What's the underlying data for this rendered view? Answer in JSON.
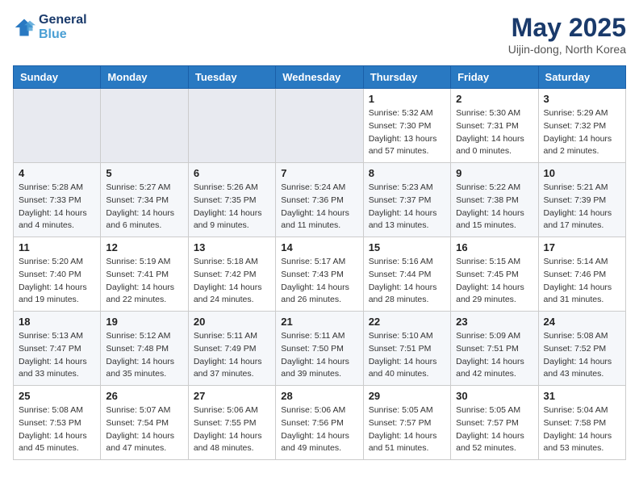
{
  "header": {
    "logo_line1": "General",
    "logo_line2": "Blue",
    "month_title": "May 2025",
    "location": "Uijin-dong, North Korea"
  },
  "weekdays": [
    "Sunday",
    "Monday",
    "Tuesday",
    "Wednesday",
    "Thursday",
    "Friday",
    "Saturday"
  ],
  "weeks": [
    [
      {
        "day": "",
        "info": ""
      },
      {
        "day": "",
        "info": ""
      },
      {
        "day": "",
        "info": ""
      },
      {
        "day": "",
        "info": ""
      },
      {
        "day": "1",
        "info": "Sunrise: 5:32 AM\nSunset: 7:30 PM\nDaylight: 13 hours\nand 57 minutes."
      },
      {
        "day": "2",
        "info": "Sunrise: 5:30 AM\nSunset: 7:31 PM\nDaylight: 14 hours\nand 0 minutes."
      },
      {
        "day": "3",
        "info": "Sunrise: 5:29 AM\nSunset: 7:32 PM\nDaylight: 14 hours\nand 2 minutes."
      }
    ],
    [
      {
        "day": "4",
        "info": "Sunrise: 5:28 AM\nSunset: 7:33 PM\nDaylight: 14 hours\nand 4 minutes."
      },
      {
        "day": "5",
        "info": "Sunrise: 5:27 AM\nSunset: 7:34 PM\nDaylight: 14 hours\nand 6 minutes."
      },
      {
        "day": "6",
        "info": "Sunrise: 5:26 AM\nSunset: 7:35 PM\nDaylight: 14 hours\nand 9 minutes."
      },
      {
        "day": "7",
        "info": "Sunrise: 5:24 AM\nSunset: 7:36 PM\nDaylight: 14 hours\nand 11 minutes."
      },
      {
        "day": "8",
        "info": "Sunrise: 5:23 AM\nSunset: 7:37 PM\nDaylight: 14 hours\nand 13 minutes."
      },
      {
        "day": "9",
        "info": "Sunrise: 5:22 AM\nSunset: 7:38 PM\nDaylight: 14 hours\nand 15 minutes."
      },
      {
        "day": "10",
        "info": "Sunrise: 5:21 AM\nSunset: 7:39 PM\nDaylight: 14 hours\nand 17 minutes."
      }
    ],
    [
      {
        "day": "11",
        "info": "Sunrise: 5:20 AM\nSunset: 7:40 PM\nDaylight: 14 hours\nand 19 minutes."
      },
      {
        "day": "12",
        "info": "Sunrise: 5:19 AM\nSunset: 7:41 PM\nDaylight: 14 hours\nand 22 minutes."
      },
      {
        "day": "13",
        "info": "Sunrise: 5:18 AM\nSunset: 7:42 PM\nDaylight: 14 hours\nand 24 minutes."
      },
      {
        "day": "14",
        "info": "Sunrise: 5:17 AM\nSunset: 7:43 PM\nDaylight: 14 hours\nand 26 minutes."
      },
      {
        "day": "15",
        "info": "Sunrise: 5:16 AM\nSunset: 7:44 PM\nDaylight: 14 hours\nand 28 minutes."
      },
      {
        "day": "16",
        "info": "Sunrise: 5:15 AM\nSunset: 7:45 PM\nDaylight: 14 hours\nand 29 minutes."
      },
      {
        "day": "17",
        "info": "Sunrise: 5:14 AM\nSunset: 7:46 PM\nDaylight: 14 hours\nand 31 minutes."
      }
    ],
    [
      {
        "day": "18",
        "info": "Sunrise: 5:13 AM\nSunset: 7:47 PM\nDaylight: 14 hours\nand 33 minutes."
      },
      {
        "day": "19",
        "info": "Sunrise: 5:12 AM\nSunset: 7:48 PM\nDaylight: 14 hours\nand 35 minutes."
      },
      {
        "day": "20",
        "info": "Sunrise: 5:11 AM\nSunset: 7:49 PM\nDaylight: 14 hours\nand 37 minutes."
      },
      {
        "day": "21",
        "info": "Sunrise: 5:11 AM\nSunset: 7:50 PM\nDaylight: 14 hours\nand 39 minutes."
      },
      {
        "day": "22",
        "info": "Sunrise: 5:10 AM\nSunset: 7:51 PM\nDaylight: 14 hours\nand 40 minutes."
      },
      {
        "day": "23",
        "info": "Sunrise: 5:09 AM\nSunset: 7:51 PM\nDaylight: 14 hours\nand 42 minutes."
      },
      {
        "day": "24",
        "info": "Sunrise: 5:08 AM\nSunset: 7:52 PM\nDaylight: 14 hours\nand 43 minutes."
      }
    ],
    [
      {
        "day": "25",
        "info": "Sunrise: 5:08 AM\nSunset: 7:53 PM\nDaylight: 14 hours\nand 45 minutes."
      },
      {
        "day": "26",
        "info": "Sunrise: 5:07 AM\nSunset: 7:54 PM\nDaylight: 14 hours\nand 47 minutes."
      },
      {
        "day": "27",
        "info": "Sunrise: 5:06 AM\nSunset: 7:55 PM\nDaylight: 14 hours\nand 48 minutes."
      },
      {
        "day": "28",
        "info": "Sunrise: 5:06 AM\nSunset: 7:56 PM\nDaylight: 14 hours\nand 49 minutes."
      },
      {
        "day": "29",
        "info": "Sunrise: 5:05 AM\nSunset: 7:57 PM\nDaylight: 14 hours\nand 51 minutes."
      },
      {
        "day": "30",
        "info": "Sunrise: 5:05 AM\nSunset: 7:57 PM\nDaylight: 14 hours\nand 52 minutes."
      },
      {
        "day": "31",
        "info": "Sunrise: 5:04 AM\nSunset: 7:58 PM\nDaylight: 14 hours\nand 53 minutes."
      }
    ]
  ]
}
